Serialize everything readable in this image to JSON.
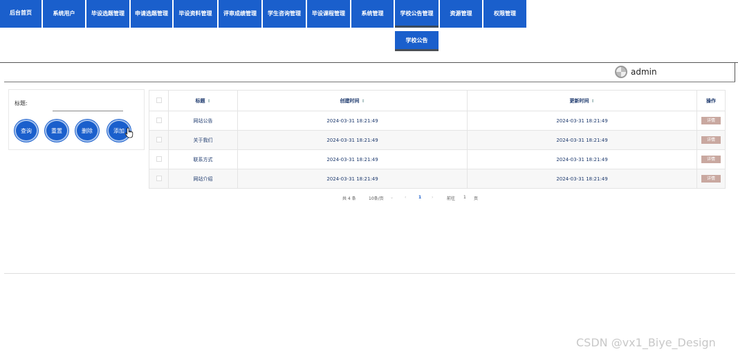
{
  "nav": {
    "items": [
      {
        "label": "后台首页"
      },
      {
        "label": "系统用户"
      },
      {
        "label": "毕设选题管理"
      },
      {
        "label": "申请选题管理"
      },
      {
        "label": "毕设资料管理"
      },
      {
        "label": "评审成绩管理"
      },
      {
        "label": "学生咨询管理"
      },
      {
        "label": "毕设课程管理"
      },
      {
        "label": "系统管理"
      },
      {
        "label": "学校公告管理"
      },
      {
        "label": "资源管理"
      },
      {
        "label": "权限管理"
      }
    ],
    "active_submenu": "学校公告"
  },
  "header": {
    "username": "admin"
  },
  "search": {
    "title_label": "标题:",
    "title_value": "",
    "buttons": {
      "query": "查询",
      "reset": "重置",
      "delete": "删除",
      "add": "添加"
    }
  },
  "table": {
    "columns": {
      "title": "标题",
      "created": "创建时间",
      "updated": "更新时间",
      "actions": "操作"
    },
    "rows": [
      {
        "title": "网站公告",
        "created": "2024-03-31 18:21:49",
        "updated": "2024-03-31 18:21:49",
        "action": "详情"
      },
      {
        "title": "关于我们",
        "created": "2024-03-31 18:21:49",
        "updated": "2024-03-31 18:21:49",
        "action": "详情"
      },
      {
        "title": "联系方式",
        "created": "2024-03-31 18:21:49",
        "updated": "2024-03-31 18:21:49",
        "action": "详情"
      },
      {
        "title": "网站介绍",
        "created": "2024-03-31 18:21:49",
        "updated": "2024-03-31 18:21:49",
        "action": "详情"
      }
    ]
  },
  "pagination": {
    "total": "共 4 条",
    "page_size": "10条/页",
    "current_page": "1",
    "goto_label": "前往",
    "goto_value": "1",
    "page_suffix": "页"
  },
  "watermark": "CSDN @vx1_Biye_Design",
  "colors": {
    "primary": "#1a5fcc",
    "detail_button": "#c9a8a0"
  },
  "icons": {
    "sort": "sort-caret-icon",
    "cursor": "hand-pointer-icon",
    "avatar": "avatar-icon"
  }
}
